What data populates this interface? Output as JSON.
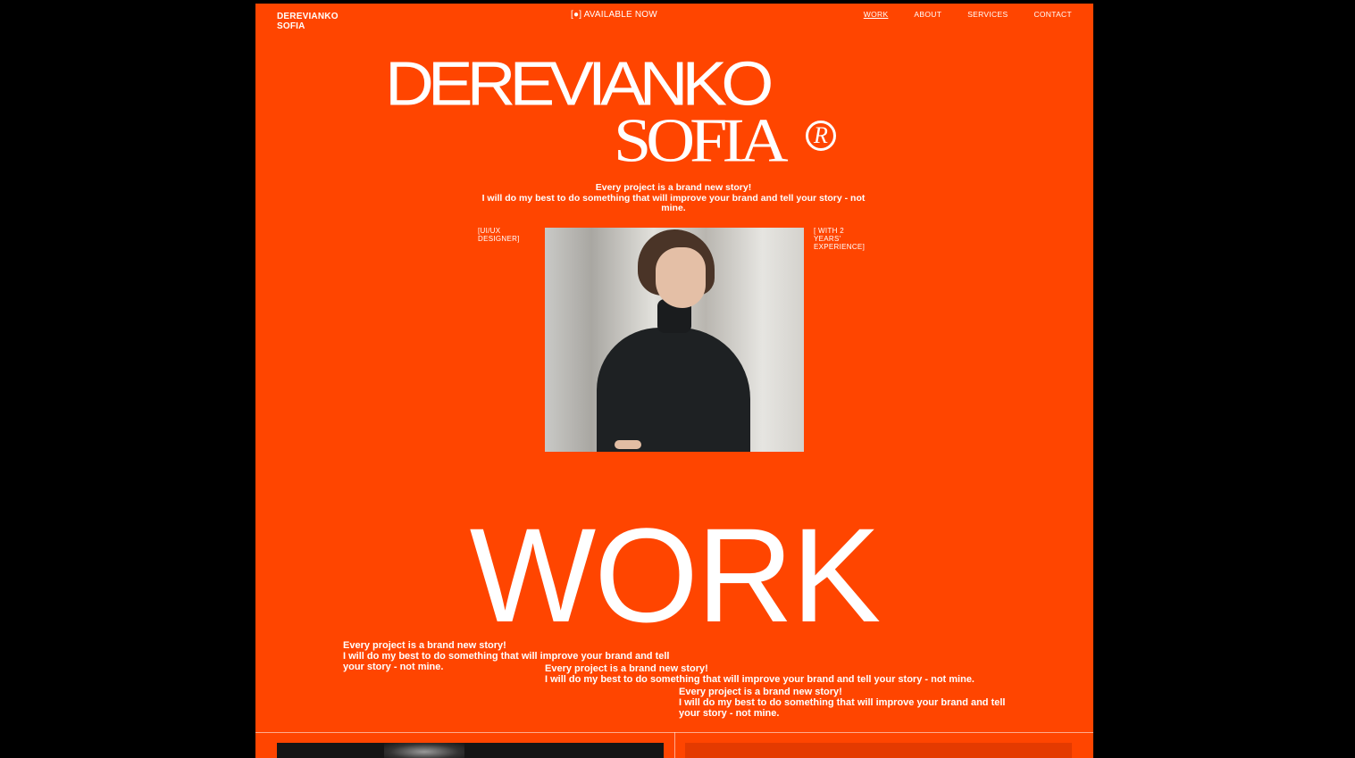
{
  "header": {
    "logo_line1": "DEREVIANKO",
    "logo_line2": "SOFIA",
    "status": "[●] AVAILABLE NOW"
  },
  "nav": {
    "items": [
      "WORK",
      "ABOUT",
      "SERVICES",
      "CONTACT"
    ],
    "active": "WORK"
  },
  "hero": {
    "line1": "DEREVIANKO",
    "line2": "SOFIA",
    "registered_mark": "R",
    "tagline": [
      "Every project is a brand new story!",
      "I will do my best to do something that will improve your brand and tell your story - not mine."
    ],
    "left_label": [
      "[UI/UX",
      "DESIGNER]"
    ],
    "right_label": [
      "[ WITH 2",
      "YEARS'",
      "EXPERIENCE]"
    ]
  },
  "work": {
    "heading": "WORK",
    "blurbs": [
      [
        "Every project is a brand new story!",
        "I will do my best to do something that will improve your brand and tell your story - not mine."
      ],
      [
        "Every project is a brand new story!",
        "I will do my best to do something that will improve your brand and tell your story - not mine."
      ],
      [
        "Every project is a brand new story!",
        "I will do my best to do something that will improve your brand and tell your story - not mine."
      ]
    ]
  },
  "colors": {
    "background": "#000000",
    "accent": "#ff4500",
    "text": "#ffffff"
  }
}
